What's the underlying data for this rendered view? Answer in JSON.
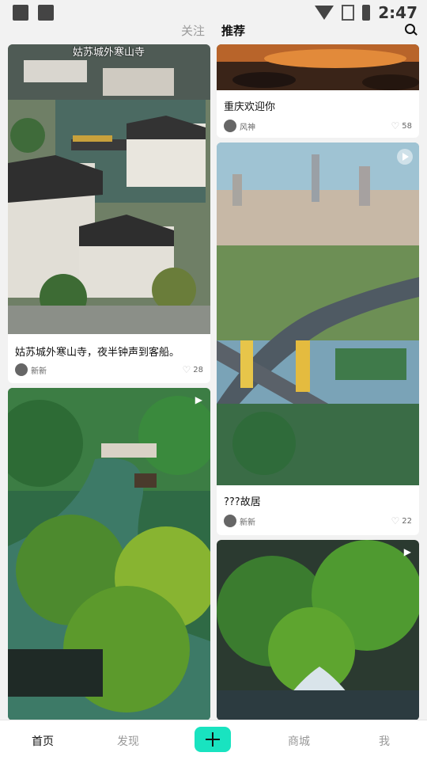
{
  "status_bar": {
    "time": "2:47",
    "icons": [
      "image-icon",
      "a-icon",
      "wifi-icon",
      "no-sim-icon",
      "battery-icon"
    ]
  },
  "top_tabs": [
    {
      "label": "关注",
      "active": false
    },
    {
      "label": "推荐",
      "active": true
    }
  ],
  "search_icon": "search-icon",
  "feed": {
    "left_column": [
      {
        "overlay_title": "姑苏城外寒山寺",
        "title": "姑苏城外寒山寺，夜半钟声到客船。",
        "author": "新新",
        "likes": "28"
      },
      {
        "media_type": "video"
      }
    ],
    "right_column": [
      {
        "title": "重庆欢迎你",
        "author": "风神",
        "likes": "58"
      },
      {
        "title": "???故居",
        "author": "新新",
        "likes": "22",
        "media_type": "video"
      },
      {
        "media_type": "video"
      }
    ]
  },
  "bottom_nav": {
    "items": [
      {
        "label": "首页",
        "active": true
      },
      {
        "label": "发现",
        "active": false
      },
      {
        "label": "商城",
        "active": false
      },
      {
        "label": "我",
        "active": false
      }
    ],
    "add_icon": "plus-icon"
  },
  "colors": {
    "accent": "#19e3c0",
    "background": "#f2f2f2"
  }
}
